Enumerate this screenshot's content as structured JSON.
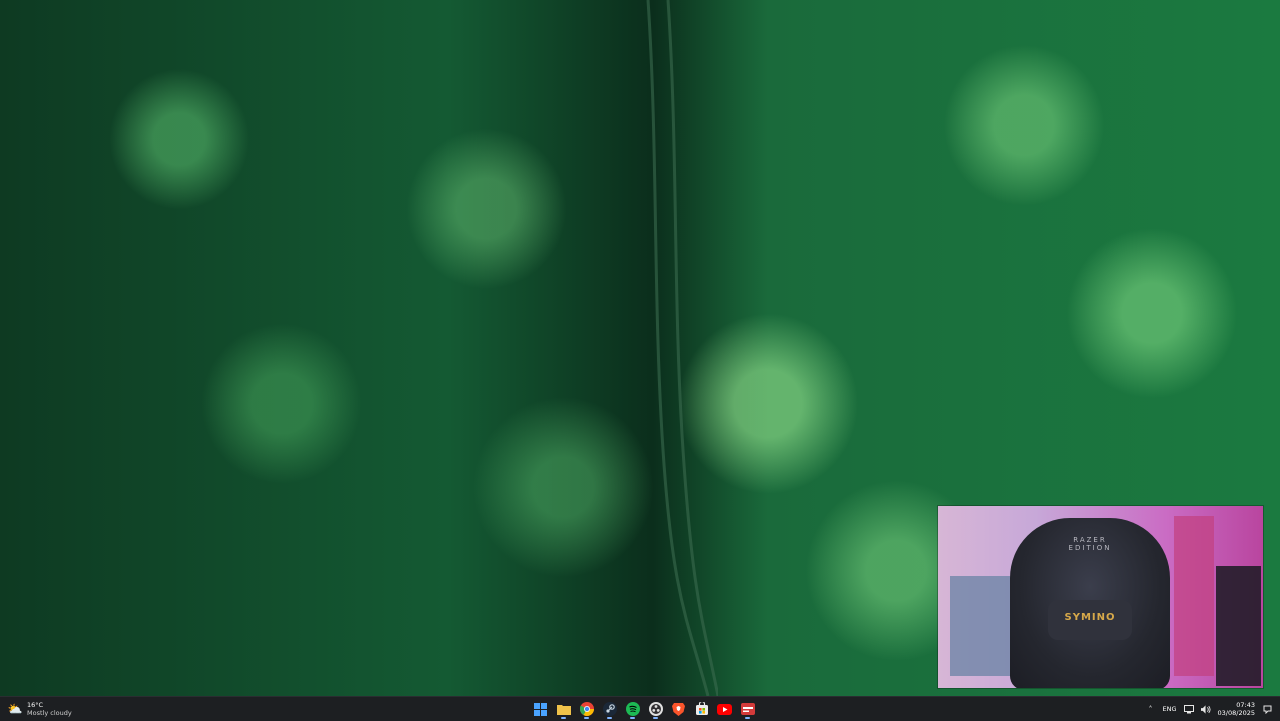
{
  "webcam": {
    "chair_brand_line1": "RAZER",
    "chair_brand_line2": "EDITION",
    "pillow_text": "SYMINO"
  },
  "taskbar": {
    "weather": {
      "temperature": "16°C",
      "condition": "Mostly cloudy",
      "icon": "sun-behind-cloud-icon"
    },
    "apps": [
      {
        "name": "start-button",
        "icon": "windows-logo-icon",
        "color": "#4aa3ff"
      },
      {
        "name": "file-explorer",
        "icon": "folder-icon",
        "color": "#f0c24a"
      },
      {
        "name": "chrome",
        "icon": "chrome-icon",
        "color": "#e94235"
      },
      {
        "name": "steam",
        "icon": "steam-icon",
        "color": "#1b2838"
      },
      {
        "name": "spotify",
        "icon": "spotify-icon",
        "color": "#1db954"
      },
      {
        "name": "obs",
        "icon": "obs-icon",
        "color": "#e0e0e0"
      },
      {
        "name": "brave",
        "icon": "brave-icon",
        "color": "#fb542b"
      },
      {
        "name": "microsoft-store",
        "icon": "store-icon",
        "color": "#3a8ee6"
      },
      {
        "name": "youtube",
        "icon": "youtube-icon",
        "color": "#ff0000"
      },
      {
        "name": "recording-app",
        "icon": "record-icon",
        "color": "#d33a3a"
      }
    ],
    "tray": {
      "language": "ENG",
      "time": "07:43",
      "date": "03/08/2025"
    }
  }
}
